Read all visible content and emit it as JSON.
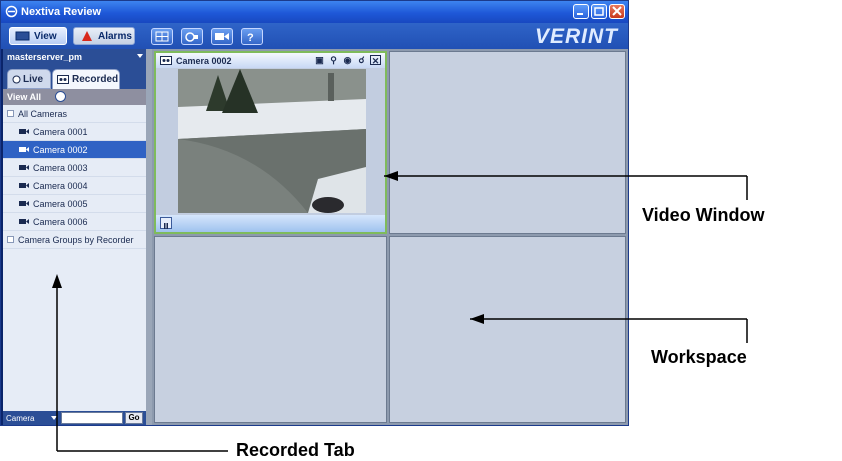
{
  "window": {
    "title": "Nextiva Review",
    "brand": "VERINT"
  },
  "toolbar": {
    "view_label": "View",
    "alarms_label": "Alarms",
    "icons": [
      "layout-icon",
      "camera-icon",
      "video-icon",
      "help-icon"
    ]
  },
  "sidebar": {
    "server": "masterserver_pm",
    "tab_live": "Live",
    "tab_recorded": "Recorded",
    "view_all": "View All",
    "tree": {
      "all_cameras": "All Cameras",
      "cameras": [
        "Camera 0001",
        "Camera 0002",
        "Camera 0003",
        "Camera 0004",
        "Camera 0005",
        "Camera 0006"
      ],
      "selected_index": 1,
      "groups": "Camera Groups by Recorder"
    },
    "search": {
      "type": "Camera",
      "value": "",
      "go": "Go"
    }
  },
  "video_window": {
    "camera": "Camera 0002"
  },
  "callouts": {
    "video_window": "Video Window",
    "workspace": "Workspace",
    "recorded_tab": "Recorded Tab"
  },
  "colors": {
    "titlebar": "#2a62da",
    "selection": "#2f62c4",
    "pane_border": "#7fbb5c"
  }
}
